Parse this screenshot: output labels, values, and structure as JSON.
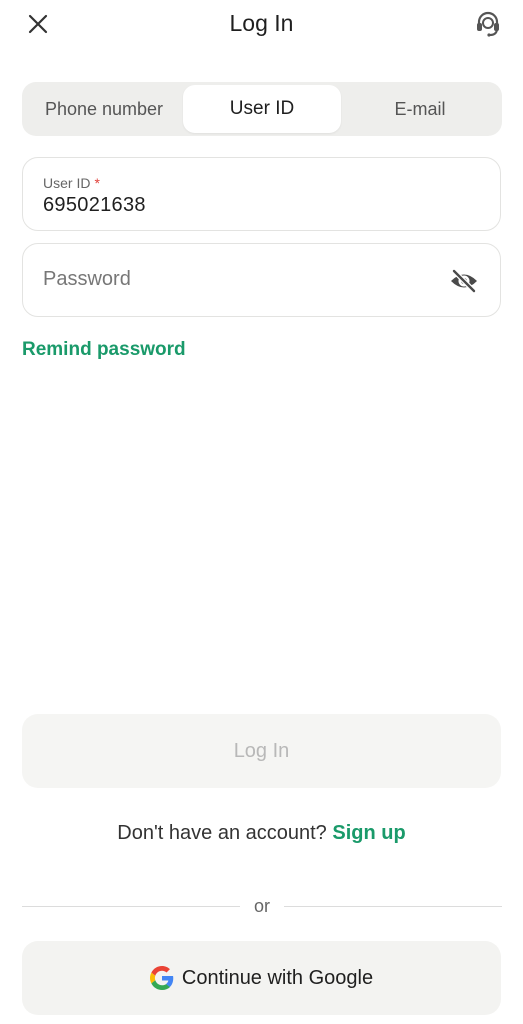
{
  "header": {
    "title": "Log In",
    "close_icon": "close-icon",
    "support_icon": "support-headset-icon"
  },
  "tabs": [
    {
      "label": "Phone number",
      "active": false
    },
    {
      "label": "User ID",
      "active": true
    },
    {
      "label": "E-mail",
      "active": false
    }
  ],
  "form": {
    "user_id": {
      "label": "User ID",
      "required_mark": "*",
      "value": "695021638"
    },
    "password": {
      "placeholder": "Password",
      "value": "",
      "visibility_icon": "eye-off-icon"
    },
    "remind_password": "Remind password"
  },
  "actions": {
    "login_label": "Log In",
    "no_account_text": "Don't have an account?",
    "signup_label": "Sign up",
    "or_text": "or",
    "google_label": "Continue with Google"
  },
  "colors": {
    "accent": "#1a9a6a",
    "required": "#e0403a",
    "disabled_text": "#b8b8b8"
  }
}
